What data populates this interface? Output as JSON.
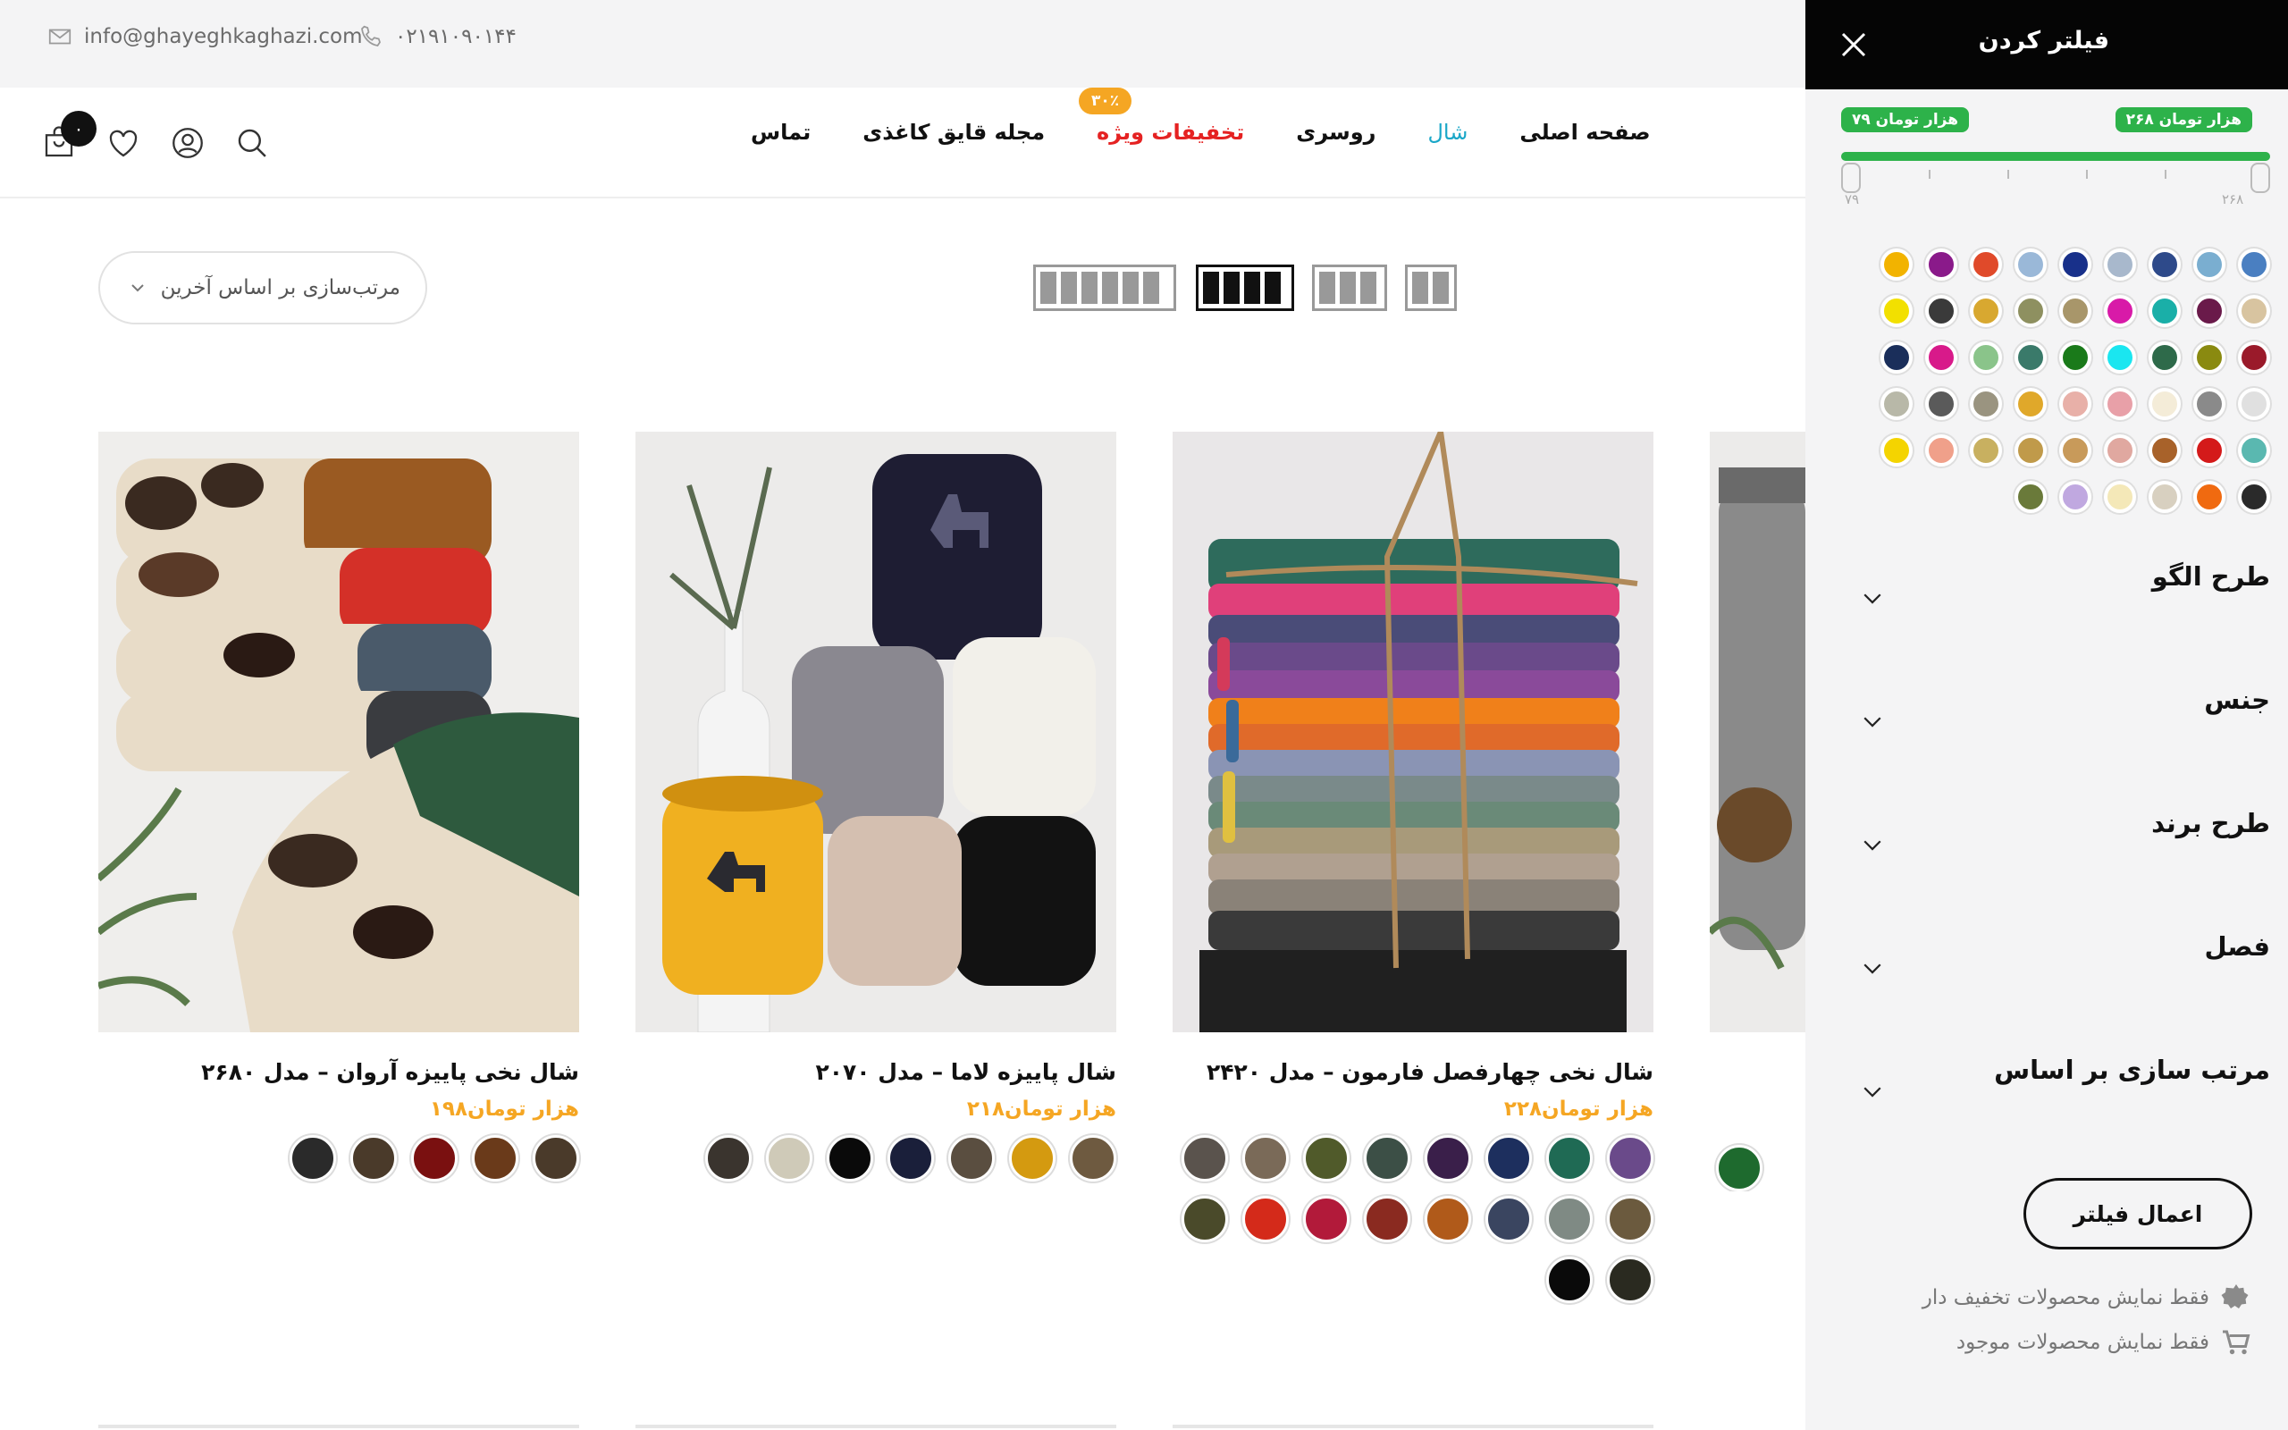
{
  "topbar": {
    "email": "info@ghayeghkaghazi.com",
    "phone": "۰۲۱۹۱۰۹۰۱۴۴"
  },
  "nav": {
    "items": [
      {
        "label": "صفحه اصلی"
      },
      {
        "label": "شال"
      },
      {
        "label": "روسری"
      },
      {
        "label": "تخفیفات ویژه"
      },
      {
        "label": "مجله قایق کاغذی"
      },
      {
        "label": "تماس"
      }
    ],
    "active_item": "شال",
    "special_badge": "۳۰٪",
    "cart_count": "۰",
    "accent_color": "#1aa7c8",
    "special_color": "#e52222"
  },
  "toolbar": {
    "sort_value": "مرتب‌سازی بر اساس آخرین",
    "grid_options": [
      "2 columns",
      "3 columns",
      "4 columns",
      "6 columns"
    ],
    "grid_selected": "4 columns"
  },
  "products": [
    {
      "title": "شال نخی چهارفصل فارمون – مدل ۲۴۲۰",
      "price": "۲۲۸هزار تومان",
      "swatches": [
        "#6a4a8a",
        "#1f6a54",
        "#1d2f5e",
        "#3a1f4a",
        "#3c4f46",
        "#505a2a",
        "#7a6a58",
        "#5a534d",
        "#6b5a3e",
        "#7f8a84",
        "#3a4560",
        "#b05a1a",
        "#8a2a20",
        "#b21a3a",
        "#d42a1a",
        "#4a4a2a",
        "#2a2a20",
        "#0a0a0a"
      ]
    },
    {
      "title": "شال پاییزه لاما – مدل ۲۰۷۰",
      "price": "۲۱۸هزار تومان",
      "swatches": [
        "#6e5a40",
        "#d49a10",
        "#5a4e40",
        "#1a1f3a",
        "#0a0a0a",
        "#cfcab8",
        "#3a342e"
      ]
    },
    {
      "title": "شال نخی پاییزه آروان – مدل ۲۶۸۰",
      "price": "۱۹۸هزار تومان",
      "swatches": [
        "#4a3a2a",
        "#6a3a1a",
        "#7a1010",
        "#4a3a2a",
        "#2a2a2a"
      ]
    }
  ],
  "filter_panel": {
    "title": "فیلتر کردن",
    "price_max_tag": "۲۶۸ هزار تومان",
    "price_min_tag": "۷۹ هزار تومان",
    "range_max": "۲۶۸",
    "range_min": "۷۹",
    "colors": [
      "#4a7fc1",
      "#7aaed0",
      "#2e4a8a",
      "#a8b8cc",
      "#18308a",
      "#9ab8d8",
      "#e04a2a",
      "#8a1a8a",
      "#f2b300",
      "#d8c4a0",
      "#6a1a4a",
      "#1aafa8",
      "#d81aa8",
      "#a8966a",
      "#8e9060",
      "#d8a830",
      "#3a3a3a",
      "#f2e000",
      "#9a1a2a",
      "#8a8a10",
      "#2e6a4a",
      "#1ae6f0",
      "#1a7a1a",
      "#3a7a6a",
      "#8ac48a",
      "#d81a8a",
      "#1a2e5a",
      "#e0e0e0",
      "#8a8a8a",
      "#f4ecd8",
      "#e8a0a8",
      "#e8b0a8",
      "#e0a82a",
      "#9a9480",
      "#5a5a5a",
      "#b8b8a8",
      "#5ab8b0",
      "#d41a1a",
      "#a8622a",
      "#e0a8a0",
      "#c89a5a",
      "#c09a4a",
      "#c8b060",
      "#f0a08a",
      "#f4d400",
      "#2a2a2a",
      "#f06a10",
      "#d8d0c0",
      "#f4e8b8",
      "#c0a8e0",
      "#6a7a3a"
    ],
    "sections": [
      {
        "label": "طرح الگو"
      },
      {
        "label": "جنس"
      },
      {
        "label": "طرح برند"
      },
      {
        "label": "فصل"
      },
      {
        "label": "مرتب سازی بر اساس"
      }
    ],
    "apply_label": "اعمال فیلتر",
    "only_discounted": "فقط نمایش محصولات تخفیف دار",
    "only_in_stock": "فقط نمایش محصولات موجود",
    "accent_color": "#2db24a"
  }
}
